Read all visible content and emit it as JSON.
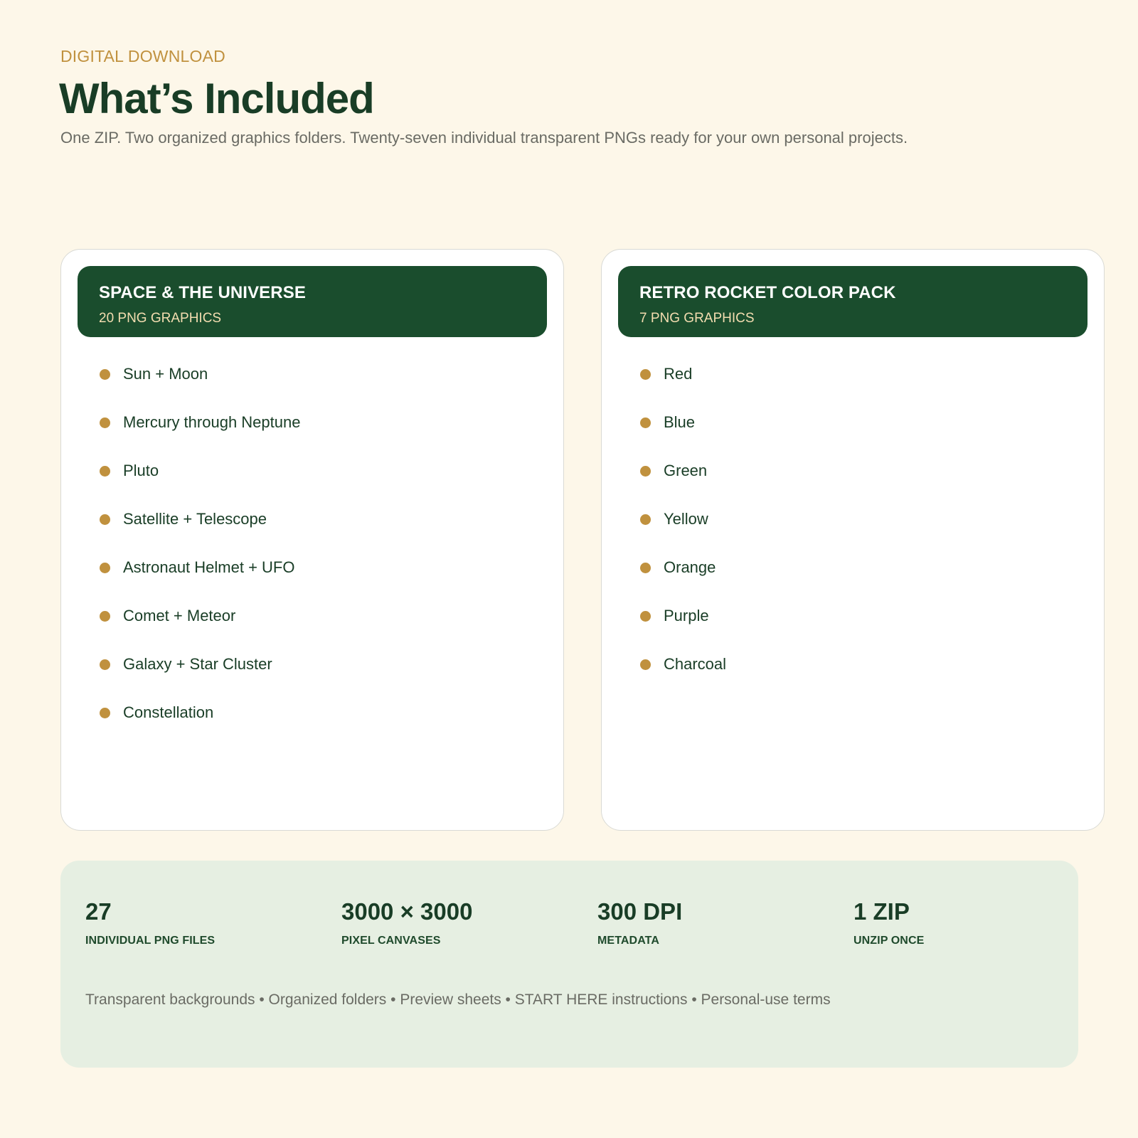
{
  "header": {
    "eyebrow": "DIGITAL DOWNLOAD",
    "title": "What’s Included",
    "subtitle": "One ZIP. Two organized graphics folders. Twenty-seven individual transparent PNGs ready for your own personal projects."
  },
  "cards": [
    {
      "title": "SPACE & THE UNIVERSE",
      "count": "20 PNG GRAPHICS",
      "items": [
        "Sun + Moon",
        "Mercury through Neptune",
        "Pluto",
        "Satellite + Telescope",
        "Astronaut Helmet + UFO",
        "Comet + Meteor",
        "Galaxy + Star Cluster",
        "Constellation"
      ]
    },
    {
      "title": "RETRO ROCKET COLOR PACK",
      "count": "7 PNG GRAPHICS",
      "items": [
        "Red",
        "Blue",
        "Green",
        "Yellow",
        "Orange",
        "Purple",
        "Charcoal"
      ]
    }
  ],
  "summary": {
    "stats": [
      {
        "value": "27",
        "label": "INDIVIDUAL PNG FILES"
      },
      {
        "value": "3000 × 3000",
        "label": "PIXEL CANVASES"
      },
      {
        "value": "300 DPI",
        "label": "METADATA"
      },
      {
        "value": "1 ZIP",
        "label": "UNZIP ONCE"
      }
    ],
    "features": "Transparent backgrounds • Organized folders • Preview sheets • START HERE instructions • Personal-use terms"
  },
  "colors": {
    "background": "#fdf7e9",
    "accent_gold": "#c0913e",
    "dark_green": "#1a4d2d",
    "title_green": "#193d26",
    "summary_bg": "#e6efe2"
  }
}
